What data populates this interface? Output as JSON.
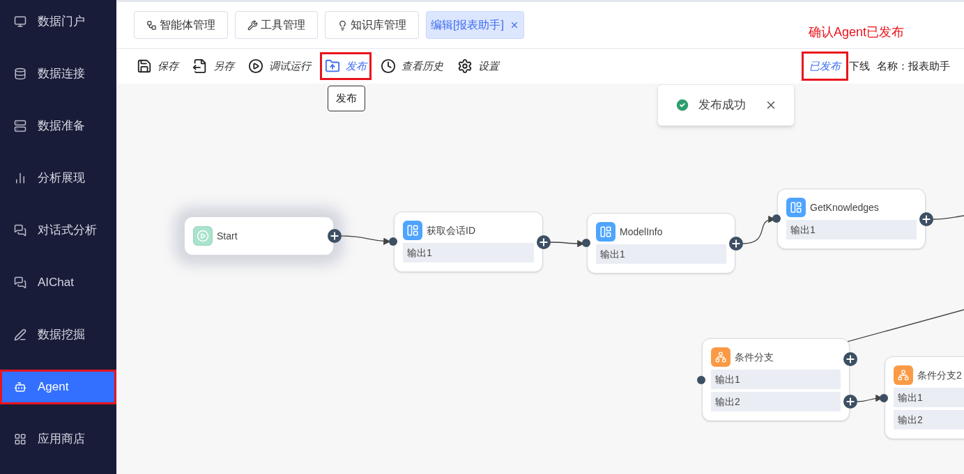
{
  "sidebar": {
    "items": [
      {
        "label": "数据门户",
        "selected": false,
        "annotated": false
      },
      {
        "label": "数据连接",
        "selected": false,
        "annotated": false
      },
      {
        "label": "数据准备",
        "selected": false,
        "annotated": false
      },
      {
        "label": "分析展现",
        "selected": false,
        "annotated": false
      },
      {
        "label": "对话式分析",
        "selected": false,
        "annotated": false
      },
      {
        "label": "AIChat",
        "selected": false,
        "annotated": false
      },
      {
        "label": "数据挖掘",
        "selected": false,
        "annotated": false
      },
      {
        "label": "Agent",
        "selected": true,
        "annotated": true
      },
      {
        "label": "应用商店",
        "selected": false,
        "annotated": false
      }
    ]
  },
  "tabs": [
    {
      "label": "智能体管理",
      "selected": false,
      "closable": false
    },
    {
      "label": "工具管理",
      "selected": false,
      "closable": false
    },
    {
      "label": "知识库管理",
      "selected": false,
      "closable": false
    },
    {
      "label": "编辑[报表助手]",
      "selected": true,
      "closable": true
    }
  ],
  "annotation": "确认Agent已发布",
  "toolbar": {
    "actions": [
      {
        "label": "保存",
        "hovered": false,
        "annotated": false
      },
      {
        "label": "另存",
        "hovered": false,
        "annotated": false
      },
      {
        "label": "调试运行",
        "hovered": false,
        "annotated": false
      },
      {
        "label": "发布",
        "hovered": true,
        "annotated": true
      },
      {
        "label": "查看历史",
        "hovered": false,
        "annotated": false
      },
      {
        "label": "设置",
        "hovered": false,
        "annotated": false
      }
    ],
    "tooltip": "发布",
    "status": {
      "label": "已发布",
      "annotated": true
    },
    "offline": "下线",
    "name": "名称：报表助手"
  },
  "toast": {
    "message": "发布成功"
  },
  "nodes": [
    {
      "kind": "start",
      "title": "Start",
      "focused": true
    },
    {
      "kind": "process",
      "title": "获取会话ID",
      "focused": false,
      "outputs": [
        "输出1"
      ]
    },
    {
      "kind": "process",
      "title": "ModelInfo",
      "focused": false,
      "outputs": [
        "输出1"
      ]
    },
    {
      "kind": "process",
      "title": "GetKnowledges",
      "focused": false,
      "outputs": [
        "输出1"
      ]
    },
    {
      "kind": "branch",
      "title": "条件分支",
      "focused": false,
      "outputs": [
        "输出1",
        "输出2"
      ]
    },
    {
      "kind": "branch",
      "title": "条件分支2",
      "focused": false,
      "outputs": [
        "输出1",
        "输出2"
      ]
    }
  ]
}
